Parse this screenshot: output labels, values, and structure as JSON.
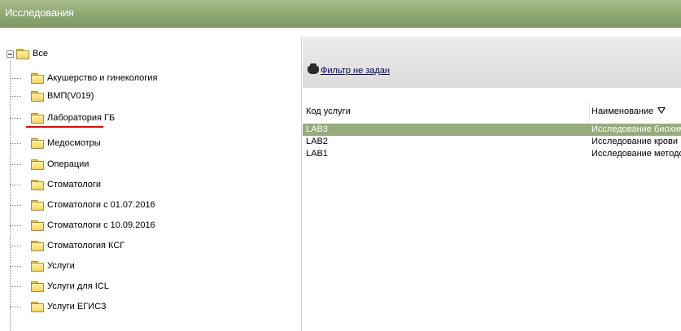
{
  "window": {
    "title": "Исследования"
  },
  "tree": {
    "root_label": "Все",
    "items": [
      {
        "label": "Акушерство и гинекология"
      },
      {
        "label": "ВМП(V019)"
      },
      {
        "label": "Лаборатория ГБ"
      },
      {
        "label": "Медосмотры"
      },
      {
        "label": "Операции"
      },
      {
        "label": "Стоматологи"
      },
      {
        "label": "Стоматологи с 01.07.2016"
      },
      {
        "label": "Стоматологи с 10.09.2016"
      },
      {
        "label": "Стоматология КСГ"
      },
      {
        "label": "Услуги"
      },
      {
        "label": "Услуги для ICL"
      },
      {
        "label": "Услуги ЕГИСЗ"
      }
    ]
  },
  "filter": {
    "label": "Фильтр не задан"
  },
  "grid": {
    "columns": [
      "Код услуги",
      "Наименование"
    ],
    "rows": [
      {
        "code": "LAB3",
        "name": "Исследование биохимия",
        "selected": true
      },
      {
        "code": "LAB2",
        "name": "Исследование крови",
        "selected": false
      },
      {
        "code": "LAB1",
        "name": "Исследование методом ПЦ",
        "selected": false
      }
    ]
  },
  "colors": {
    "titlebar": "#8ea772",
    "selection": "#97ac7b",
    "annotation": "#e00000"
  }
}
